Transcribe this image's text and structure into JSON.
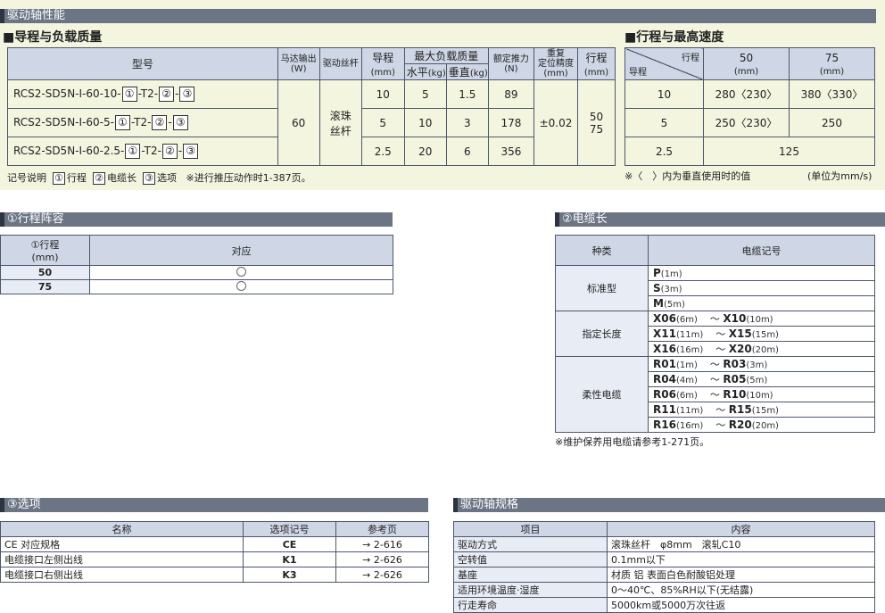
{
  "header": {
    "section_title": "驱动轴性能"
  },
  "perf": {
    "title": "■导程与负载质量",
    "col_model": "型号",
    "col_motor": "马达输出",
    "col_motor_unit": "(W)",
    "col_drive": "驱动丝杆",
    "col_lead": "导程",
    "col_lead_unit": "(mm)",
    "col_load": "最大负载质量",
    "col_load_h": "水平",
    "col_load_h_unit": "(kg)",
    "col_load_v": "垂直",
    "col_load_v_unit": "(kg)",
    "col_thrust": "额定推力",
    "col_thrust_unit": "(N)",
    "col_repeat_1": "重复",
    "col_repeat_2": "定位精度",
    "col_repeat_unit": "(mm)",
    "col_stroke": "行程",
    "col_stroke_unit": "(mm)",
    "rows": [
      {
        "model_a": "RCS2-SD5N-I-60-10-",
        "lead": "10",
        "h": "5",
        "v": "1.5",
        "thrust": "89"
      },
      {
        "model_a": "RCS2-SD5N-I-60-5-",
        "lead": "5",
        "h": "10",
        "v": "3",
        "thrust": "178"
      },
      {
        "model_a": "RCS2-SD5N-I-60-2.5-",
        "lead": "2.5",
        "h": "20",
        "v": "6",
        "thrust": "356"
      }
    ],
    "sym1": "①",
    "sym_t2": "-T2-",
    "sym2": "②",
    "dash": "-",
    "sym3": "③",
    "motor": "60",
    "drive_1": "滚珠",
    "drive_2": "丝杆",
    "repeat": "±0.02",
    "stroke_1": "50",
    "stroke_2": "75",
    "legend_label": "记号说明",
    "legend_1": "行程",
    "legend_2": "电缆长",
    "legend_3": "选项",
    "legend_note": "※进行推压动作时1-387页。"
  },
  "speed": {
    "title": "■行程与最高速度",
    "corner_top": "行程",
    "corner_bottom": "导程",
    "col_50": "50",
    "col_75": "75",
    "col_unit": "(mm)",
    "rows": [
      {
        "lead": "10",
        "s50": "280〈230〉",
        "s75": "380〈330〉"
      },
      {
        "lead": "5",
        "s50": "250〈230〉",
        "s75": "250"
      },
      {
        "lead": "2.5",
        "merged": "125"
      }
    ],
    "note": "※〈　〉内为垂直使用时的值",
    "unit": "(单位为mm/s)"
  },
  "stroke_list": {
    "section_title": "①行程阵容",
    "col_stroke": "①行程",
    "col_stroke_unit": "(mm)",
    "col_support": "对应",
    "rows": [
      "50",
      "75"
    ]
  },
  "cable": {
    "section_title": "②电缆长",
    "col_type": "种类",
    "col_code": "电缆记号",
    "groups": [
      {
        "type": "标准型",
        "rows": [
          [
            "P",
            "(1m)"
          ],
          [
            "S",
            "(3m)"
          ],
          [
            "M",
            "(5m)"
          ]
        ]
      },
      {
        "type": "指定长度",
        "rows": [
          [
            "X06",
            "(6m)",
            "X10",
            "(10m)"
          ],
          [
            "X11",
            "(11m)",
            "X15",
            "(15m)"
          ],
          [
            "X16",
            "(16m)",
            "X20",
            "(20m)"
          ]
        ]
      },
      {
        "type": "柔性电缆",
        "rows": [
          [
            "R01",
            "(1m)",
            "R03",
            "(3m)"
          ],
          [
            "R04",
            "(4m)",
            "R05",
            "(5m)"
          ],
          [
            "R06",
            "(6m)",
            "R10",
            "(10m)"
          ],
          [
            "R11",
            "(11m)",
            "R15",
            "(15m)"
          ],
          [
            "R16",
            "(16m)",
            "R20",
            "(20m)"
          ]
        ]
      }
    ],
    "tilde": "～",
    "note": "※维护保养用电缆请参考1-271页。"
  },
  "options": {
    "section_title": "③选项",
    "col_name": "名称",
    "col_code": "选项记号",
    "col_page": "参考页",
    "rows": [
      {
        "name": "CE 对应规格",
        "code": "CE",
        "page": "→ 2-616"
      },
      {
        "name": "电缆接口左侧出线",
        "code": "K1",
        "page": "→ 2-626"
      },
      {
        "name": "电缆接口右侧出线",
        "code": "K3",
        "page": "→ 2-626"
      }
    ]
  },
  "spec": {
    "section_title": "驱动轴规格",
    "col_item": "项目",
    "col_content": "内容",
    "rows": [
      {
        "item": "驱动方式",
        "content": "滚珠丝杆　φ8mm　滚轧C10"
      },
      {
        "item": "空转值",
        "content": "0.1mm以下"
      },
      {
        "item": "基座",
        "content": "材质 铝 表面白色耐酸铝处理"
      },
      {
        "item": "适用环境温度·湿度",
        "content": "0～40℃、85%RH以下(无结露)"
      },
      {
        "item": "行走寿命",
        "content": "5000km或5000万次往返"
      }
    ]
  }
}
